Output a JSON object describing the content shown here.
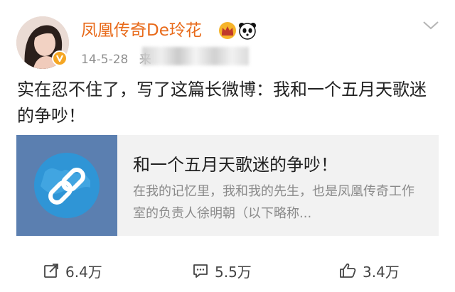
{
  "header": {
    "username": "凤凰传奇De玲花",
    "date": "14-5-28",
    "source_partial": "来"
  },
  "post": {
    "text": "实在忍不住了，写了这篇长微博：我和一个五月天歌迷的争吵！"
  },
  "card": {
    "title": "和一个五月天歌迷的争吵！",
    "description": "在我的记忆里，我和我的先生，也是凤凰传奇工作室的负责人徐明朝（以下略称..."
  },
  "actions": {
    "repost": "6.4万",
    "comment": "5.5万",
    "like": "3.4万"
  },
  "colors": {
    "username": "#e86a1a",
    "verified_badge": "#f5a623",
    "card_thumb": "#5b7fb0",
    "card_background": "#f2f2f2"
  },
  "icons": [
    "verified-icon",
    "crown-icon",
    "panda-icon",
    "chevron-down-icon",
    "link-icon",
    "repost-icon",
    "comment-icon",
    "like-icon"
  ]
}
